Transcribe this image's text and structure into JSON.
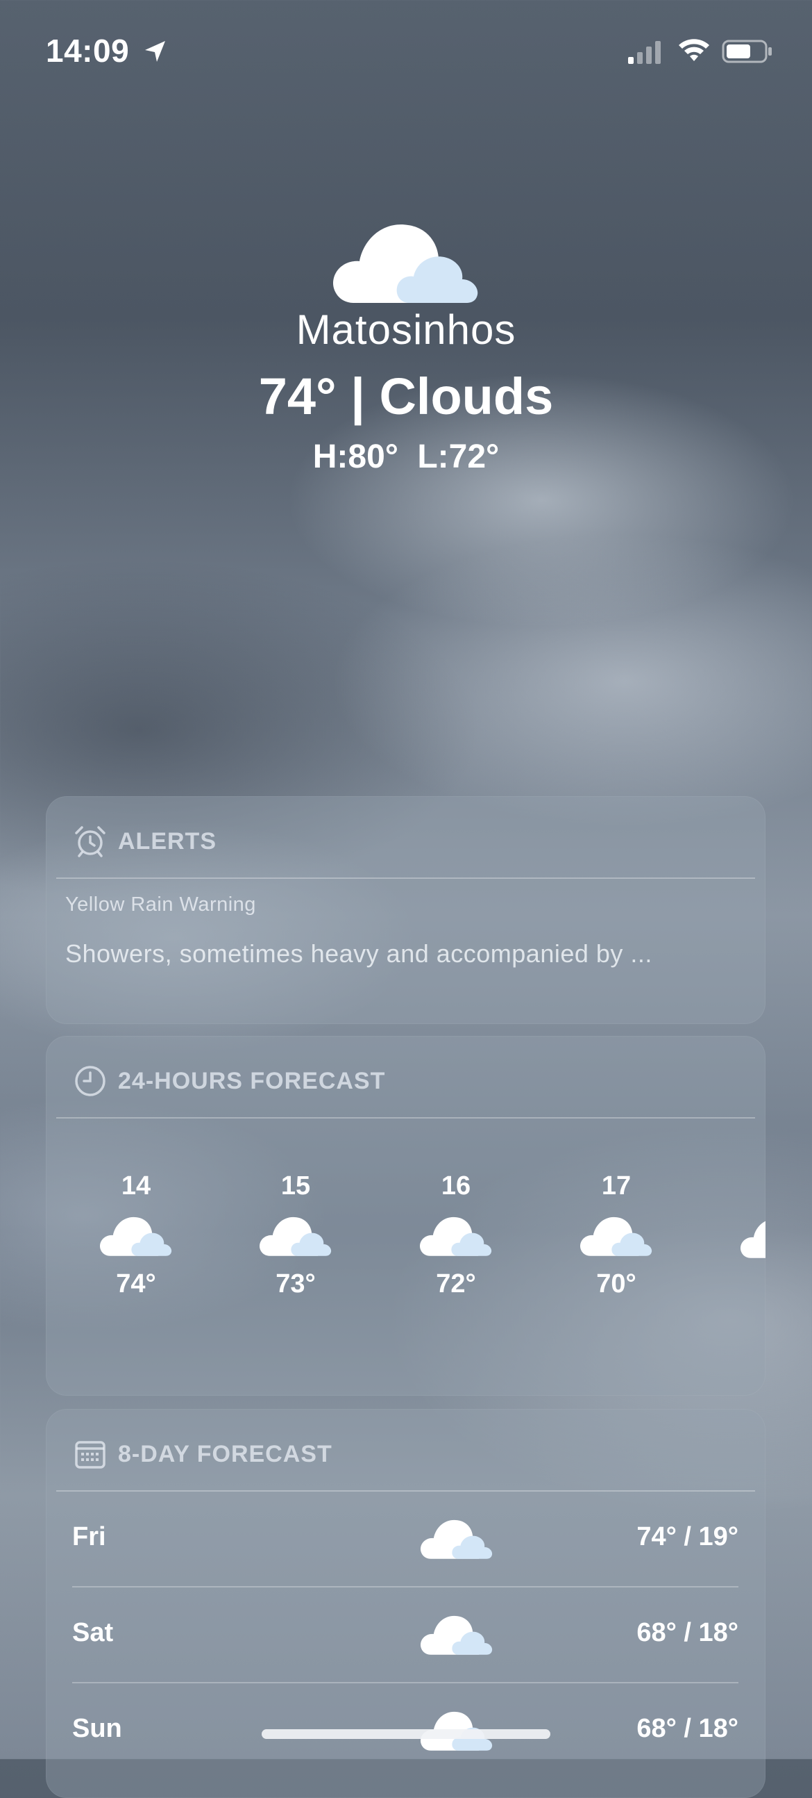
{
  "status_bar": {
    "time": "14:09"
  },
  "header": {
    "city": "Matosinhos",
    "summary": "74° | Clouds",
    "high_low": "H:80°  L:72°"
  },
  "alerts": {
    "title": "ALERTS",
    "alert_name": "Yellow Rain Warning",
    "alert_text": "Showers, sometimes heavy and accompanied by ..."
  },
  "hourly": {
    "title": "24-HOURS FORECAST",
    "items": [
      {
        "hour": "14",
        "temp": "74°",
        "icon": "cloud-icon"
      },
      {
        "hour": "15",
        "temp": "73°",
        "icon": "cloud-icon"
      },
      {
        "hour": "16",
        "temp": "72°",
        "icon": "cloud-icon"
      },
      {
        "hour": "17",
        "temp": "70°",
        "icon": "cloud-icon"
      }
    ]
  },
  "daily": {
    "title": "8-DAY FORECAST",
    "items": [
      {
        "day": "Fri",
        "temps": "74° / 19°",
        "icon": "cloud-icon"
      },
      {
        "day": "Sat",
        "temps": "68° / 18°",
        "icon": "cloud-icon"
      },
      {
        "day": "Sun",
        "temps": "68° / 18°",
        "icon": "cloud-icon"
      }
    ]
  }
}
